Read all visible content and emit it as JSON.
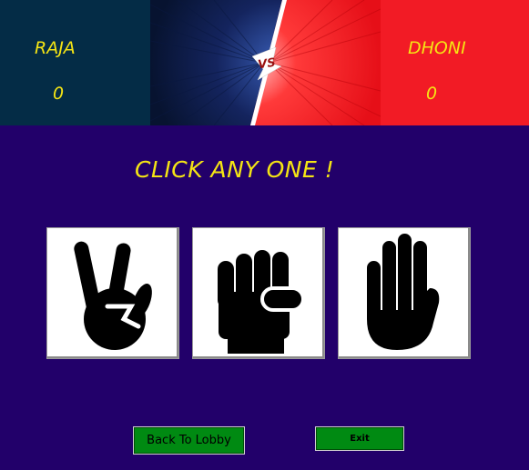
{
  "players": {
    "left": {
      "name": "RAJA",
      "score": "0"
    },
    "right": {
      "name": "DHONI",
      "score": "0"
    }
  },
  "versus_label": "VS",
  "prompt": "CLICK ANY ONE !",
  "choices": [
    {
      "icon": "scissors-hand-icon"
    },
    {
      "icon": "rock-fist-icon"
    },
    {
      "icon": "paper-palm-icon"
    }
  ],
  "buttons": {
    "back_to_lobby": "Back To Lobby",
    "exit": "Exit"
  },
  "colors": {
    "background": "#22006a",
    "left_panel": "#042c46",
    "right_panel": "#f21b25",
    "text_accent": "#f5e514",
    "button": "#008a12"
  }
}
